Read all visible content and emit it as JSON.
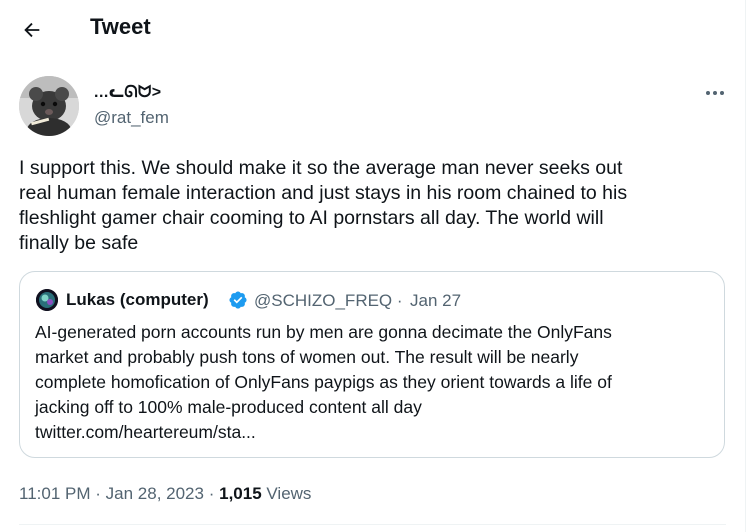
{
  "header": {
    "title": "Tweet",
    "back_icon": "arrow-left-icon"
  },
  "author": {
    "display_name": "...ᓚᘏᗢ>",
    "handle": "@rat_fem",
    "more_icon": "more-horizontal-icon"
  },
  "tweet": {
    "text": "I support this. We should make it so the average man never seeks out\nreal human female interaction and just stays in his room chained to his\nfleshlight gamer chair cooming to AI pornstars all day. The world will\nfinally be safe"
  },
  "quoted_tweet": {
    "name": "Lukas (computer)",
    "handle": "@SCHIZO_FREQ",
    "separator": "·",
    "date": "Jan 27",
    "verified": true,
    "verified_color": "#1d9bf0",
    "text": "AI-generated porn accounts run by men are gonna decimate the OnlyFans\nmarket and probably push tons of women out. The result will be nearly\ncomplete homofication of OnlyFans paypigs as they orient towards a life of\njacking off to 100% male-produced content all day\ntwitter.com/heartereum/sta..."
  },
  "meta": {
    "time": "11:01 PM",
    "sep1": "·",
    "date": "Jan 28, 2023",
    "sep2": "·",
    "views_count": "1,015",
    "views_label": "Views"
  }
}
